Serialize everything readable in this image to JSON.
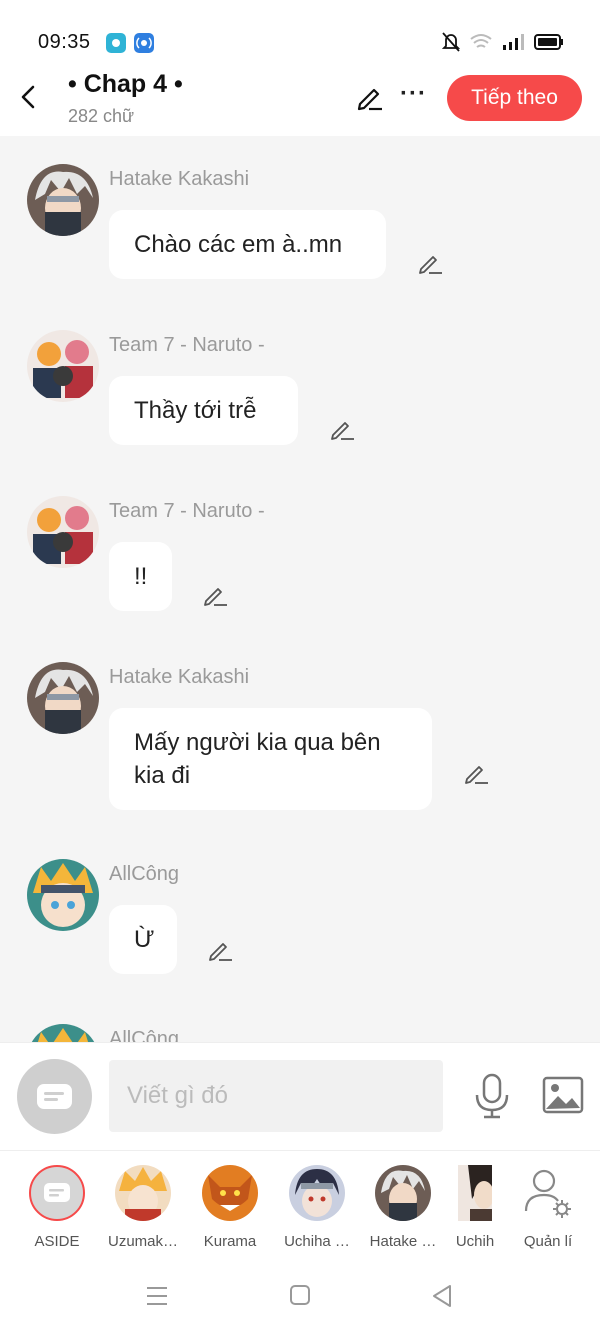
{
  "status_bar": {
    "time": "09:35"
  },
  "header": {
    "title": "• Chap 4 •",
    "subtitle": "282 chữ",
    "next_button": "Tiếp theo"
  },
  "messages": [
    {
      "name": "Hatake Kakashi",
      "text": "Chào các em à..mn",
      "avatar": "kakashi"
    },
    {
      "name": "Team 7 - Naruto -",
      "text": "Thầy tới trễ",
      "avatar": "team7"
    },
    {
      "name": "Team 7 - Naruto -",
      "text": "!!",
      "avatar": "team7"
    },
    {
      "name": "Hatake Kakashi",
      "text": "Mấy người kia qua bên kia đi",
      "avatar": "kakashi"
    },
    {
      "name": "AllCông",
      "text": "Ừ",
      "avatar": "naruto"
    },
    {
      "name": "AllCông",
      "text": "",
      "avatar": "naruto"
    }
  ],
  "input": {
    "placeholder": "Viết gì đó"
  },
  "characters": [
    {
      "label": "ASIDE"
    },
    {
      "label": "Uzumak…"
    },
    {
      "label": "Kurama"
    },
    {
      "label": "Uchiha …"
    },
    {
      "label": "Hatake …"
    },
    {
      "label": "Uchih"
    },
    {
      "label": "Quản lí"
    }
  ],
  "colors": {
    "accent": "#f64a4a",
    "background": "#f5f5f5",
    "bubble": "#ffffff",
    "name_text": "#9a9a9a"
  }
}
